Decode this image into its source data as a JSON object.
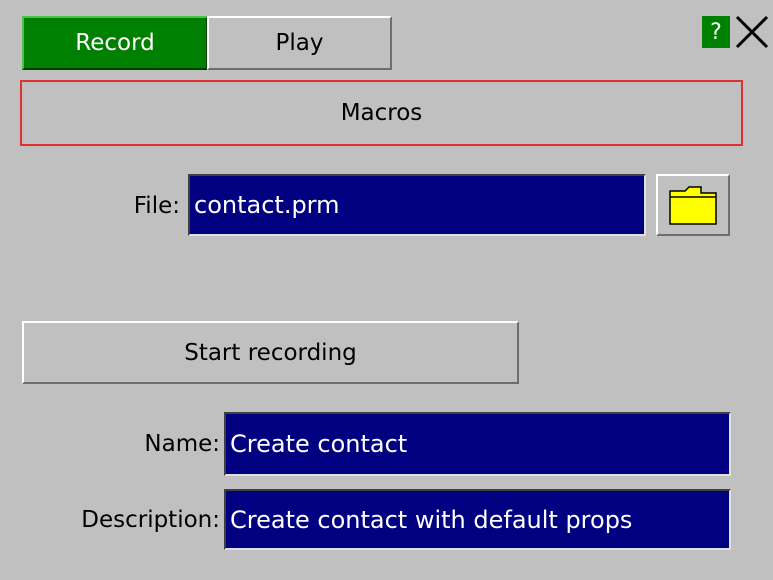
{
  "tabs": [
    {
      "label": "Record",
      "active": true
    },
    {
      "label": "Play",
      "active": false
    }
  ],
  "help_label": "?",
  "close_label": "X",
  "section_title": "Macros",
  "file": {
    "label": "File:",
    "value": "contact.prm",
    "browse_icon": "folder-icon"
  },
  "start_button_label": "Start recording",
  "name": {
    "label": "Name:",
    "value": "Create contact"
  },
  "description": {
    "label": "Description:",
    "value": "Create contact with default props"
  },
  "colors": {
    "active_tab": "#008000",
    "field_bg": "#000080",
    "section_border": "#e03030",
    "folder": "#ffff00"
  }
}
